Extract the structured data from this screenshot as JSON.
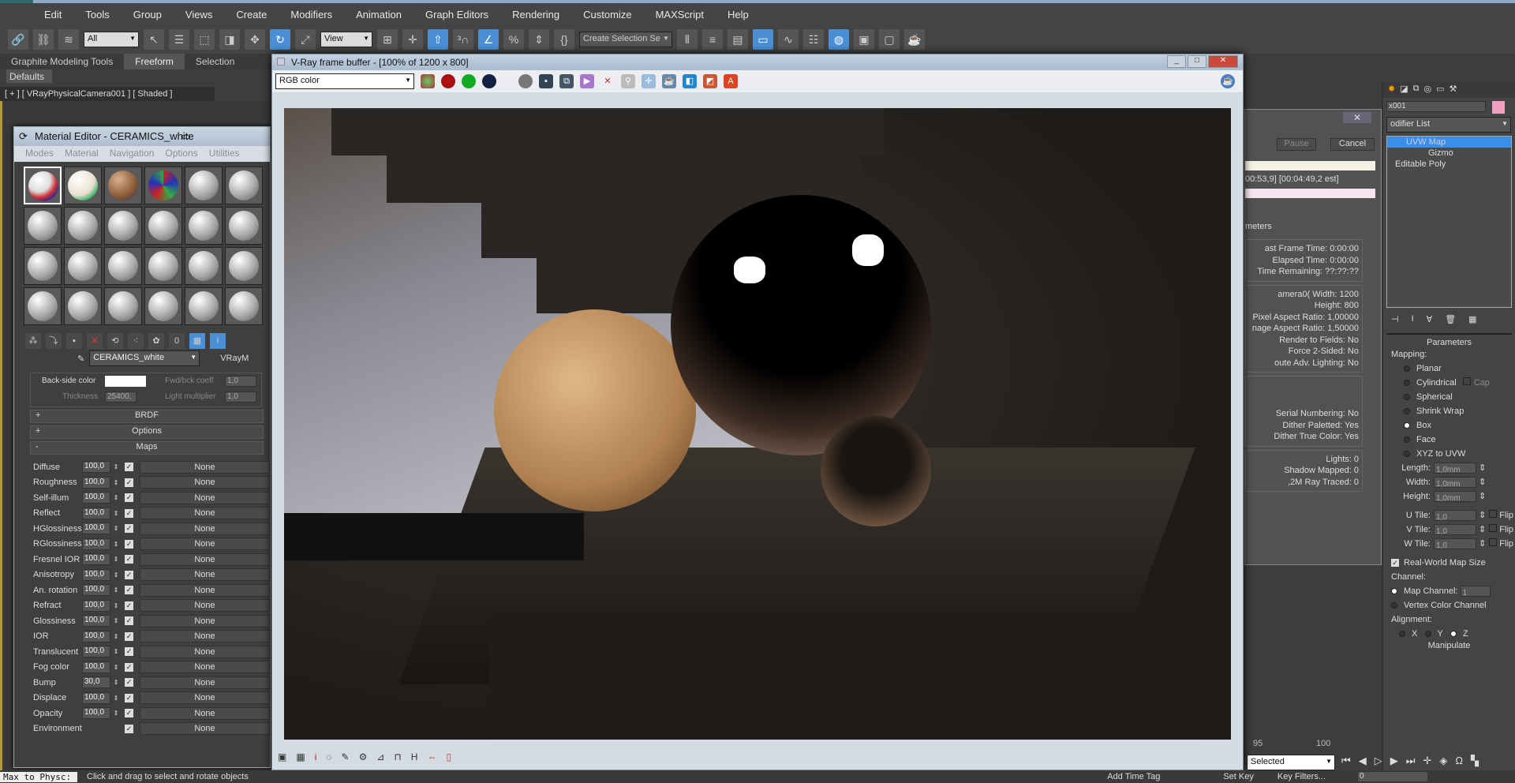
{
  "app": {
    "menu": [
      "Edit",
      "Tools",
      "Group",
      "Views",
      "Create",
      "Modifiers",
      "Animation",
      "Graph Editors",
      "Rendering",
      "Customize",
      "MAXScript",
      "Help"
    ],
    "toolbar": {
      "selection_filter": "All",
      "ref_coord": "View",
      "named_selection": "Create Selection Se"
    },
    "ribbon_tabs": [
      "Graphite Modeling Tools",
      "Freeform",
      "Selection"
    ],
    "ribbon_active": "Freeform",
    "defaults_label": "Defaults",
    "viewport_label": "[ + ] [ VRayPhysicalCamera001 ] [ Shaded ]"
  },
  "material_editor": {
    "title": "Material Editor - CERAMICS_white",
    "menu": [
      "Modes",
      "Material",
      "Navigation",
      "Options",
      "Utilities"
    ],
    "material_name": "CERAMICS_white",
    "material_type": "VRayM",
    "back_side_color_label": "Back-side color",
    "fwd_bck_label": "Fwd/bck coeff",
    "fwd_bck_value": "1,0",
    "thickness_label": "Thickness",
    "thickness_value": "25400,",
    "light_mult_label": "Light multiplier",
    "light_mult_value": "1,0",
    "rollups": [
      {
        "sign": "+",
        "label": "BRDF"
      },
      {
        "sign": "+",
        "label": "Options"
      },
      {
        "sign": "-",
        "label": "Maps"
      }
    ],
    "maps": [
      {
        "name": "Diffuse",
        "amount": "100,0",
        "map": "None"
      },
      {
        "name": "Roughness",
        "amount": "100,0",
        "map": "None"
      },
      {
        "name": "Self-illum",
        "amount": "100,0",
        "map": "None"
      },
      {
        "name": "Reflect",
        "amount": "100,0",
        "map": "None"
      },
      {
        "name": "HGlossiness",
        "amount": "100,0",
        "map": "None"
      },
      {
        "name": "RGlossiness",
        "amount": "100,0",
        "map": "None"
      },
      {
        "name": "Fresnel IOR",
        "amount": "100,0",
        "map": "None"
      },
      {
        "name": "Anisotropy",
        "amount": "100,0",
        "map": "None"
      },
      {
        "name": "An. rotation",
        "amount": "100,0",
        "map": "None"
      },
      {
        "name": "Refract",
        "amount": "100,0",
        "map": "None"
      },
      {
        "name": "Glossiness",
        "amount": "100,0",
        "map": "None"
      },
      {
        "name": "IOR",
        "amount": "100,0",
        "map": "None"
      },
      {
        "name": "Translucent",
        "amount": "100,0",
        "map": "None"
      },
      {
        "name": "Fog color",
        "amount": "100,0",
        "map": "None"
      },
      {
        "name": "Bump",
        "amount": "30,0",
        "map": "None"
      },
      {
        "name": "Displace",
        "amount": "100,0",
        "map": "None"
      },
      {
        "name": "Opacity",
        "amount": "100,0",
        "map": "None"
      },
      {
        "name": "Environment",
        "amount": "",
        "map": "None"
      }
    ]
  },
  "vfb": {
    "title": "V-Ray frame buffer - [100% of 1200 x 800]",
    "channel": "RGB color"
  },
  "progress": {
    "pause": "Pause",
    "cancel": "Cancel",
    "time_text": "00:53,9] [00:04:49,2 est]",
    "section": "meters",
    "times": [
      "ast Frame Time:  0:00:00",
      "Elapsed Time:  0:00:00",
      "Time Remaining: ??:??:??"
    ],
    "render_info": [
      "amera0(     Width: 1200",
      "Height: 800",
      "Pixel Aspect Ratio: 1,00000",
      "nage Aspect Ratio: 1,50000",
      "Render to Fields: No",
      "Force 2-Sided: No",
      "oute Adv. Lighting: No"
    ],
    "output": [
      "Serial Numbering: No",
      "Dither Paletted: Yes",
      "Dither True Color: Yes"
    ],
    "scene": [
      "Lights: 0",
      "Shadow Mapped: 0",
      ",2M      Ray Traced: 0"
    ]
  },
  "command_panel": {
    "object_name": "x001",
    "modifier_list": "odifier List",
    "stack": [
      "UVW Map",
      "Gizmo",
      "Editable Poly"
    ],
    "parameters": "Parameters",
    "mapping_label": "Mapping:",
    "mapping": [
      {
        "label": "Planar",
        "on": false
      },
      {
        "label": "Cylindrical",
        "on": false
      },
      {
        "label": "Spherical",
        "on": false
      },
      {
        "label": "Shrink Wrap",
        "on": false
      },
      {
        "label": "Box",
        "on": true
      },
      {
        "label": "Face",
        "on": false
      },
      {
        "label": "XYZ to UVW",
        "on": false
      }
    ],
    "cap": "Cap",
    "dims": [
      {
        "label": "Length:",
        "value": "1,0mm"
      },
      {
        "label": "Width:",
        "value": "1,0mm"
      },
      {
        "label": "Height:",
        "value": "1,0mm"
      }
    ],
    "tiles": [
      {
        "label": "U Tile:",
        "value": "1,0"
      },
      {
        "label": "V Tile:",
        "value": "1,0"
      },
      {
        "label": "W Tile:",
        "value": "1,0"
      }
    ],
    "flip": "Flip",
    "real_world": "Real-World Map Size",
    "channel_label": "Channel:",
    "map_channel": "Map Channel:",
    "map_channel_value": "1",
    "vertex_color": "Vertex Color Channel",
    "alignment": "Alignment:",
    "axes": [
      "X",
      "Y",
      "Z"
    ],
    "manipulate": "Manipulate"
  },
  "timeline": {
    "ticks": [
      "95",
      "100"
    ],
    "key_mode": "Selected",
    "frame": "0",
    "key_filters": "Key Filters...",
    "set_key": "Set Key",
    "add_time_tag": "Add Time Tag"
  },
  "status": {
    "script": "Max to Physc:",
    "prompt": "Click and drag to select and rotate objects"
  }
}
